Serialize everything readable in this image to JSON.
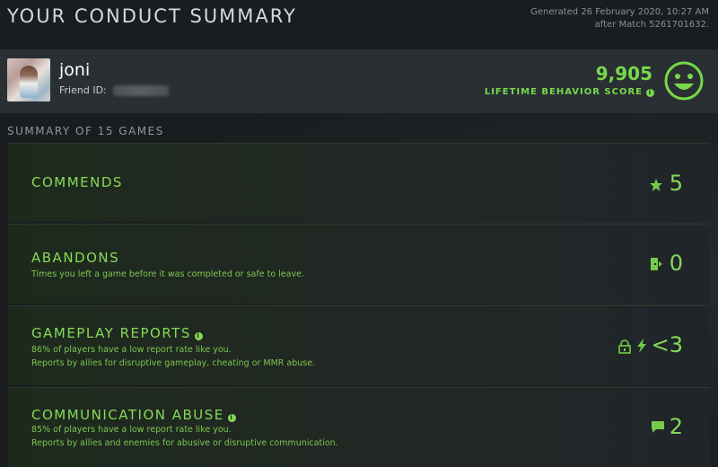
{
  "page": {
    "title": "YOUR CONDUCT SUMMARY",
    "generated_line1": "Generated 26 February 2020, 10:27 AM",
    "generated_line2": "after Match 5261701632."
  },
  "profile": {
    "username": "joni",
    "friend_id_label": "Friend ID:",
    "score": "9,905",
    "score_label": "LIFETIME BEHAVIOR SCORE",
    "score_icon": "smiley-face-icon"
  },
  "summary": {
    "heading": "SUMMARY OF 15 GAMES",
    "cards": [
      {
        "title": "COMMENDS",
        "desc1": "",
        "desc2": "",
        "value": "5",
        "icon": "star-icon"
      },
      {
        "title": "ABANDONS",
        "desc1": "Times you left a game before it was completed or safe to leave.",
        "desc2": "",
        "value": "0",
        "icon": "exit-door-icon"
      },
      {
        "title": "GAMEPLAY REPORTS",
        "desc1": "86% of players have a low report rate like you.",
        "desc2": "Reports by allies for disruptive gameplay, cheating or MMR abuse.",
        "value": "<3",
        "icon": "lock-lightning-icon"
      },
      {
        "title": "COMMUNICATION ABUSE",
        "desc1": "85% of players have a low report rate like you.",
        "desc2": "Reports by allies and enemies for abusive or disruptive communication.",
        "value": "2",
        "icon": "chat-bubble-icon"
      }
    ]
  },
  "colors": {
    "accent_green": "#86d957",
    "background": "#1a1d1f",
    "profile_bar": "#2a2f33"
  }
}
